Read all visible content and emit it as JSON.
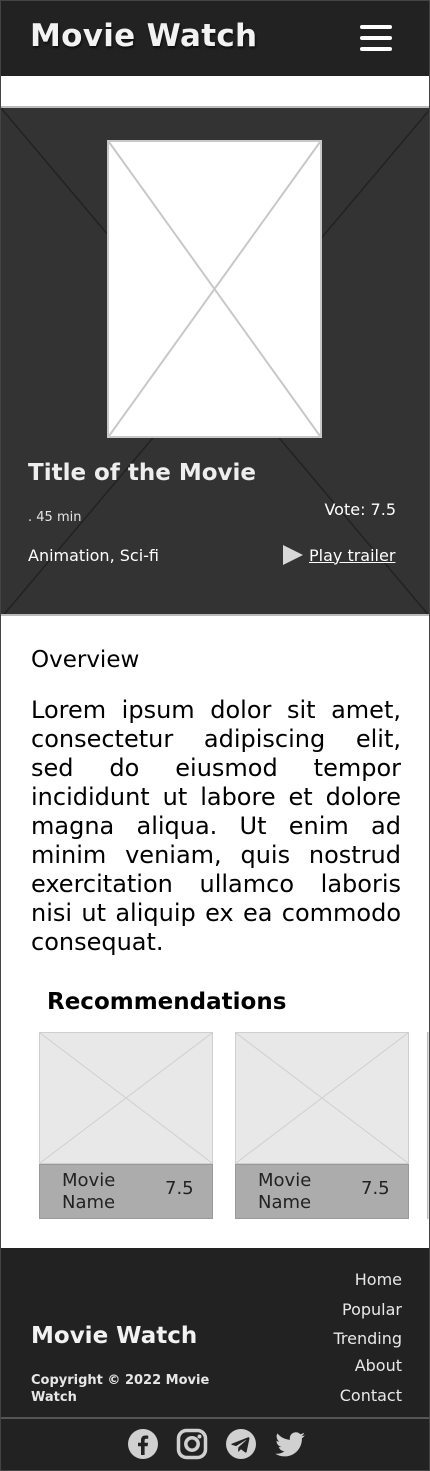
{
  "header": {
    "brand": "Movie Watch",
    "menu_icon": "hamburger-menu-icon"
  },
  "hero": {
    "poster_icon": "image-placeholder-icon",
    "title": "Title of  the Movie",
    "runtime": ". 45 min",
    "vote": "Vote: 7.5",
    "genres": "Animation, Sci-fi",
    "trailer_label": "Play trailer",
    "trailer_icon": "play-icon"
  },
  "overview": {
    "title": "Overview",
    "text": "Lorem ipsum dolor sit amet, consectetur adipiscing elit, sed do eiusmod tempor incididunt ut labore et dolore magna aliqua. Ut enim ad minim veniam, quis nostrud exercitation ullamco laboris nisi ut aliquip ex ea commodo consequat."
  },
  "recommendations": {
    "title": "Recommendations",
    "items": [
      {
        "name": "Movie Name",
        "rating": "7.5"
      },
      {
        "name": "Movie Name",
        "rating": "7.5"
      }
    ]
  },
  "footer": {
    "brand": "Movie Watch",
    "copyright": "Copyright © 2022 Movie Watch",
    "nav": [
      "Home",
      "Popular",
      "Trending",
      "About",
      "Contact"
    ],
    "social_icons": [
      "facebook-icon",
      "instagram-icon",
      "telegram-icon",
      "twitter-icon"
    ]
  },
  "colors": {
    "header_bg": "#222222",
    "hero_bg": "#333333",
    "card_info_bg": "#acacac",
    "footer_bg": "#222222"
  }
}
